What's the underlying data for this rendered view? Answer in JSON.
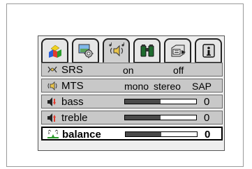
{
  "tabs": [
    {
      "icon": "shapes-icon"
    },
    {
      "icon": "gear-picture-icon"
    },
    {
      "icon": "audio-speaker-icon",
      "active": true
    },
    {
      "icon": "binoculars-icon"
    },
    {
      "icon": "input-device-icon"
    },
    {
      "icon": "info-icon"
    }
  ],
  "audio": {
    "srs": {
      "label": "SRS",
      "on": "on",
      "off": "off",
      "icon": "srs-icon"
    },
    "mts": {
      "label": "MTS",
      "mono": "mono",
      "stereo": "stereo",
      "sap": "SAP",
      "icon": "speaker-waves-icon"
    },
    "bass": {
      "label": "bass",
      "value": "0",
      "level": 0.5,
      "icon": "bass-speaker-icon"
    },
    "treble": {
      "label": "treble",
      "value": "0",
      "level": 0.5,
      "icon": "treble-speaker-icon"
    },
    "balance": {
      "label": "balance",
      "value": "0",
      "level": 0.5,
      "icon": "balance-icon"
    }
  },
  "colors": {
    "accent_yellow": "#f2d21e",
    "accent_green": "#2c9b2c"
  }
}
